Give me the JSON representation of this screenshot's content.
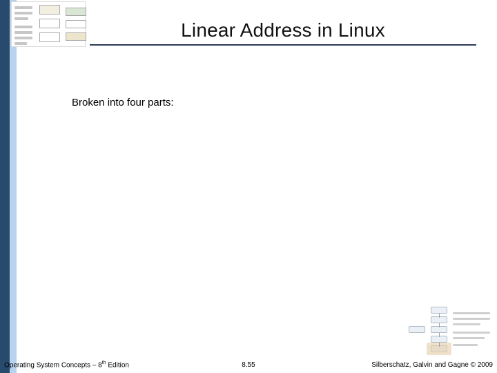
{
  "title": "Linear Address in Linux",
  "body": {
    "line1": "Broken into four parts:"
  },
  "footer": {
    "left_prefix": "Operating System Concepts – 8",
    "left_ordinal_sup": "th",
    "left_suffix": " Edition",
    "center": "8.55",
    "right": "Silberschatz, Galvin and Gagne © 2009"
  }
}
